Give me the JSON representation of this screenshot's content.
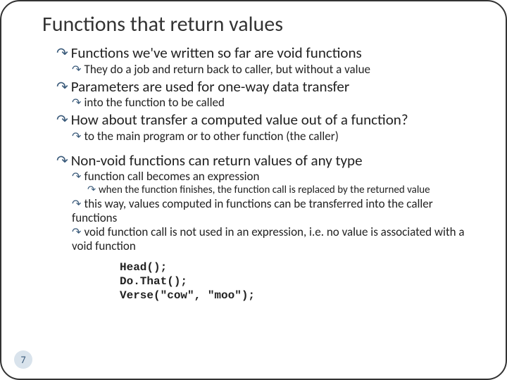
{
  "title": "Functions that return values",
  "bullets": {
    "b1": "Functions we've written so far are void functions",
    "b1a": "They do a job and return back to caller, but without a value",
    "b2": "Parameters are used for one-way data transfer",
    "b2a": "into the function to be called",
    "b3": "How about transfer a computed value out of a function?",
    "b3a": "to the main program or to other function (the caller)",
    "b4": "Non-void functions can return values of any type",
    "b4a": "function call becomes an expression",
    "b4a1": "when the function finishes, the function call is replaced by the returned value",
    "b4b": "this way, values computed in functions can be transferred into the caller functions",
    "b4c": "void function call is not used in an expression, i.e. no value is associated with a void function"
  },
  "code": "Head();\nDo.That();\nVerse(\"cow\", \"moo\");",
  "page_number": "7"
}
